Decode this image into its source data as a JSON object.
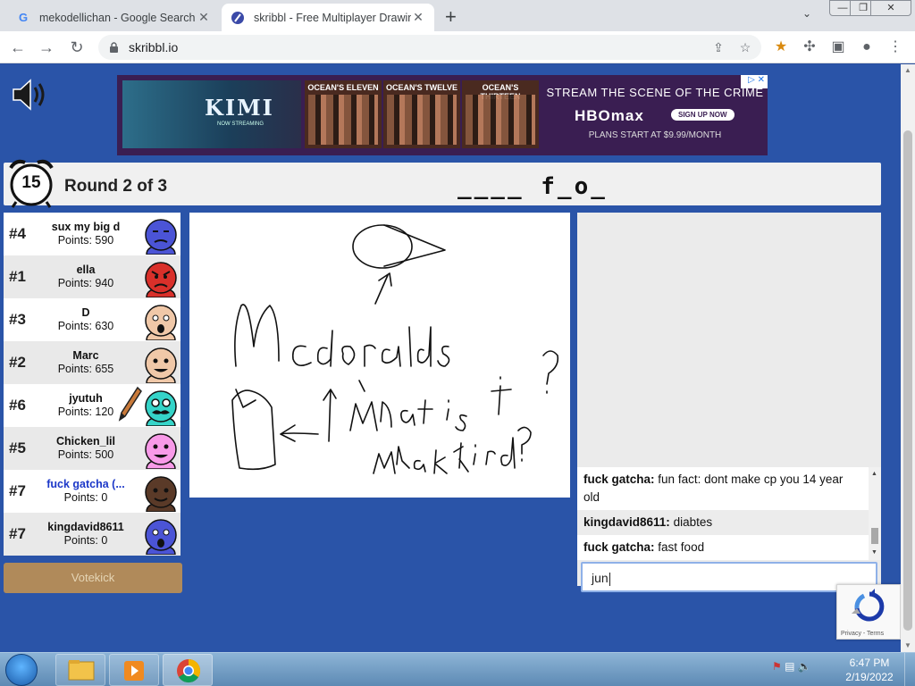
{
  "browser": {
    "tabs": [
      {
        "title": "mekodellichan - Google Search",
        "favicon": "google-icon"
      },
      {
        "title": "skribbl - Free Multiplayer Drawing",
        "favicon": "skribbl-icon"
      }
    ],
    "url": "skribbl.io"
  },
  "ad": {
    "kimi": "KIMI",
    "kimi_sub": "NOW STREAMING",
    "posters": [
      "OCEAN'S ELEVEN",
      "OCEAN'S TWELVE",
      "OCEAN'S THIRTEEN"
    ],
    "headline": "STREAM THE SCENE OF THE CRIME",
    "brand": "HBOmax",
    "cta": "SIGN UP NOW",
    "plans": "PLANS START AT $9.99/MONTH"
  },
  "game": {
    "timer": "15",
    "round": "Round 2 of 3",
    "word_hint": "____ f_o_"
  },
  "players": [
    {
      "rank": "#4",
      "name": "sux my big d",
      "points": "Points: 590",
      "color": "#4b54d6",
      "face": "calm"
    },
    {
      "rank": "#1",
      "name": "ella",
      "points": "Points: 940",
      "color": "#d9302a",
      "face": "angry"
    },
    {
      "rank": "#3",
      "name": "D",
      "points": "Points: 630",
      "color": "#f0c8a8",
      "face": "shock"
    },
    {
      "rank": "#2",
      "name": "Marc",
      "points": "Points: 655",
      "color": "#f0c8a8",
      "face": "grin"
    },
    {
      "rank": "#6",
      "name": "jyutuh",
      "points": "Points: 120",
      "color": "#35d4c8",
      "face": "mustache",
      "drawing": true
    },
    {
      "rank": "#5",
      "name": "Chicken_lil",
      "points": "Points: 500",
      "color": "#f89ae8",
      "face": "grin"
    },
    {
      "rank": "#7",
      "name": "fuck gatcha (...",
      "points": "Points: 0",
      "color": "#5a3a28",
      "face": "smile",
      "me": true
    },
    {
      "rank": "#7",
      "name": "kingdavid8611",
      "points": "Points: 0",
      "color": "#4b54d6",
      "face": "shock"
    }
  ],
  "votekick": "Votekick",
  "chat": {
    "messages": [
      {
        "user": "fuck gatcha:",
        "text": "fun fact: dont make cp you 14 year old"
      },
      {
        "user": "kingdavid8611:",
        "text": "diabtes"
      },
      {
        "user": "fuck gatcha:",
        "text": "fast food"
      }
    ],
    "input_value": "jun"
  },
  "recaptcha": {
    "label": "Privacy - Terms"
  },
  "taskbar": {
    "time": "6:47 PM",
    "date": "2/19/2022"
  },
  "colors": {
    "page_bg": "#2a54a8",
    "accent": "#1c38c8",
    "votekick": "#b08a5a"
  }
}
